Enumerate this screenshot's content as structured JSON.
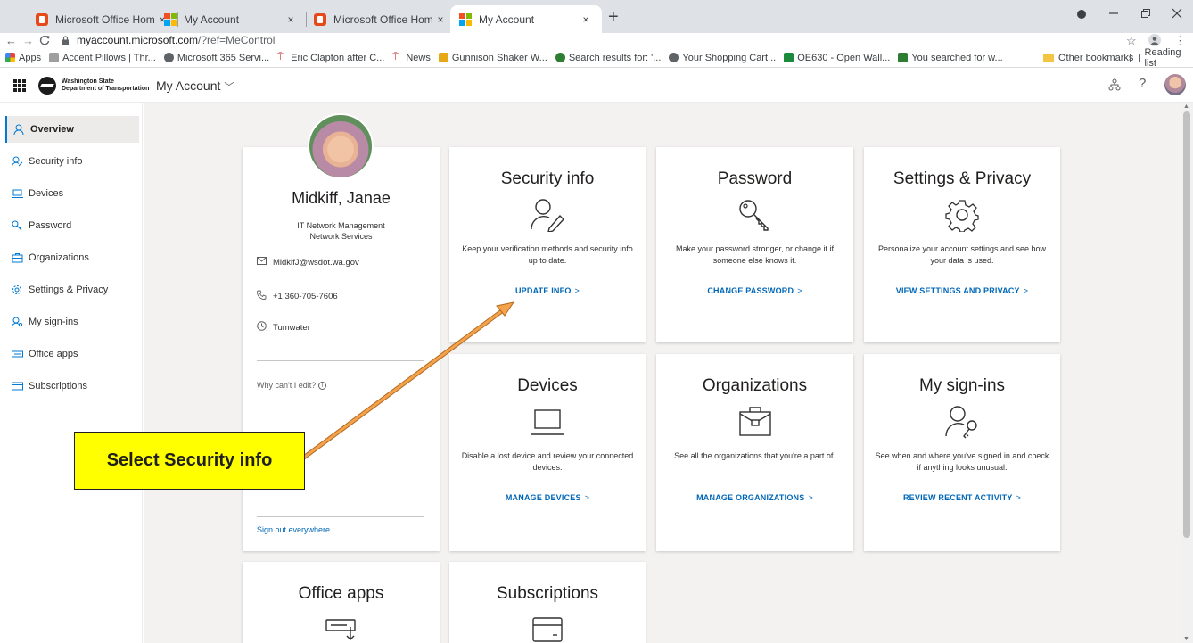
{
  "browser": {
    "tabs": [
      {
        "title": "Microsoft Office Home",
        "favicon": "office-icon"
      },
      {
        "title": "My Account",
        "favicon": "microsoft-icon"
      },
      {
        "title": "Microsoft Office Home",
        "favicon": "office-icon"
      },
      {
        "title": "My Account",
        "favicon": "microsoft-icon"
      }
    ],
    "active_tab_index": 3,
    "tab_close_glyph": "×",
    "new_tab_glyph": "+",
    "url_host": "myaccount.microsoft.com",
    "url_rest": "/?ref=MeControl",
    "bookmarks": [
      {
        "label": "Apps",
        "icon": "apps-grid-icon",
        "color": "#4285f4"
      },
      {
        "label": "Accent Pillows | Thr...",
        "icon": "site-icon",
        "color": "#9e9e9e"
      },
      {
        "label": "Microsoft 365 Servi...",
        "icon": "globe-icon",
        "color": "#5f6368"
      },
      {
        "label": "Eric Clapton after C...",
        "icon": "news-icon",
        "color": "#c62828"
      },
      {
        "label": "News",
        "icon": "news-icon",
        "color": "#c62828"
      },
      {
        "label": "Gunnison Shaker W...",
        "icon": "site-icon",
        "color": "#e6a817"
      },
      {
        "label": "Search results for: '...",
        "icon": "site-icon",
        "color": "#2e7d32"
      },
      {
        "label": "Your Shopping Cart...",
        "icon": "globe-icon",
        "color": "#5f6368"
      },
      {
        "label": "OE630 - Open Wall...",
        "icon": "site-icon",
        "color": "#1b8a3c"
      },
      {
        "label": "You searched for w...",
        "icon": "site-icon",
        "color": "#2e7d32"
      }
    ],
    "other_bookmarks": "Other bookmarks",
    "reading_list": "Reading list"
  },
  "header": {
    "org_name_line1": "Washington State",
    "org_name_line2": "Department of Transportation",
    "title": "My Account",
    "title_chevron": "﹀",
    "help_glyph": "?"
  },
  "sidebar": {
    "items": [
      {
        "label": "Overview",
        "icon": "person-icon",
        "active": true
      },
      {
        "label": "Security info",
        "icon": "person-key-icon"
      },
      {
        "label": "Devices",
        "icon": "laptop-icon"
      },
      {
        "label": "Password",
        "icon": "key-icon"
      },
      {
        "label": "Organizations",
        "icon": "briefcase-icon"
      },
      {
        "label": "Settings & Privacy",
        "icon": "gear-icon"
      },
      {
        "label": "My sign-ins",
        "icon": "person-key-icon"
      },
      {
        "label": "Office apps",
        "icon": "keyboard-icon"
      },
      {
        "label": "Subscriptions",
        "icon": "card-icon"
      }
    ]
  },
  "profile": {
    "name": "Midkiff, Janae",
    "department_line1": "IT Network Management",
    "department_line2": "Network Services",
    "email": "MidkifJ@wsdot.wa.gov",
    "phone": "+1 360-705-7606",
    "location": "Tumwater",
    "why_cant_edit": "Why can't I edit?",
    "sign_out": "Sign out everywhere"
  },
  "cards": [
    {
      "title": "Security info",
      "icon": "person-edit-icon",
      "description": "Keep your verification methods and security info up to date.",
      "link": "UPDATE INFO"
    },
    {
      "title": "Password",
      "icon": "key-icon",
      "description": "Make your password stronger, or change it if someone else knows it.",
      "link": "CHANGE PASSWORD"
    },
    {
      "title": "Settings & Privacy",
      "icon": "gear-icon",
      "description": "Personalize your account settings and see how your data is used.",
      "link": "VIEW SETTINGS AND PRIVACY"
    },
    {
      "title": "Devices",
      "icon": "laptop-icon",
      "description": "Disable a lost device and review your connected devices.",
      "link": "MANAGE DEVICES"
    },
    {
      "title": "Organizations",
      "icon": "briefcase-icon",
      "description": "See all the organizations that you're a part of.",
      "link": "MANAGE ORGANIZATIONS"
    },
    {
      "title": "My sign-ins",
      "icon": "person-key-icon",
      "description": "See when and where you've signed in and check if anything looks unusual.",
      "link": "REVIEW RECENT ACTIVITY"
    },
    {
      "title": "Office apps",
      "icon": "keyboard-icon",
      "description": "",
      "link": ""
    },
    {
      "title": "Subscriptions",
      "icon": "card-icon",
      "description": "",
      "link": ""
    }
  ],
  "link_chevron": ">",
  "annotation": {
    "callout_text": "Select Security info",
    "callout_color": "#ffff00",
    "arrow_color": "#f4a24b"
  },
  "colors": {
    "accent": "#0078d4",
    "link": "#0067b8",
    "page_bg": "#f3f2f1"
  }
}
